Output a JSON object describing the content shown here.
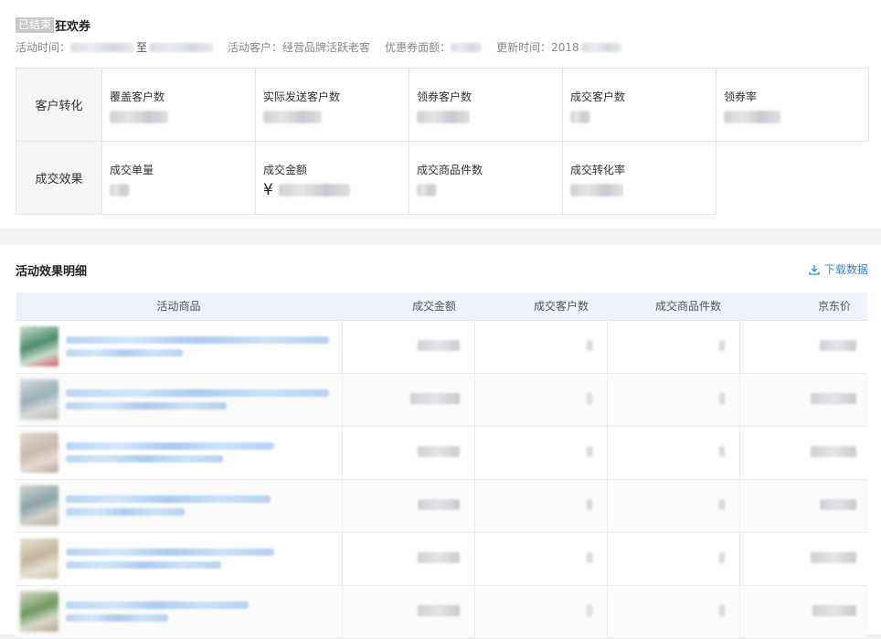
{
  "header": {
    "status_badge": "已结束",
    "title": "狂欢券"
  },
  "meta": {
    "time_label": "活动时间：",
    "time_to": "至",
    "customer_label": "活动客户：",
    "customer_value": "经营品牌活跃老客",
    "coupon_label": "优惠券面额：",
    "update_label": "更新时间：",
    "update_value": "2018"
  },
  "stats": {
    "conversion_row_label": "客户转化",
    "conversion": [
      {
        "label": "覆盖客户数"
      },
      {
        "label": "实际发送客户数"
      },
      {
        "label": "领券客户数"
      },
      {
        "label": "成交客户数"
      },
      {
        "label": "领券率"
      }
    ],
    "effect_row_label": "成交效果",
    "effect": [
      {
        "label": "成交单量"
      },
      {
        "label": "成交金额",
        "currency": "¥"
      },
      {
        "label": "成交商品件数"
      },
      {
        "label": "成交转化率"
      }
    ]
  },
  "detail": {
    "section_title": "活动效果明细",
    "download_label": "下载数据",
    "columns": [
      "活动商品",
      "成交金额",
      "成交客户数",
      "成交商品件数",
      "京东价"
    ],
    "rows": [
      {
        "thumb_colors": [
          "#4f8c6e",
          "#c7dccd",
          "#e05a6d"
        ]
      },
      {
        "thumb_colors": [
          "#9bb0b8",
          "#d6d9dc",
          "#c0b9ad"
        ]
      },
      {
        "thumb_colors": [
          "#c9b9ad",
          "#e3dad3",
          "#b5a69b"
        ]
      },
      {
        "thumb_colors": [
          "#8aa5ad",
          "#d3d0c9",
          "#b9b1a4"
        ]
      },
      {
        "thumb_colors": [
          "#c3b79a",
          "#e4e0d6",
          "#cfc5aa"
        ]
      },
      {
        "thumb_colors": [
          "#6f9a5e",
          "#d9d6c9",
          "#b4a78d"
        ]
      }
    ]
  }
}
